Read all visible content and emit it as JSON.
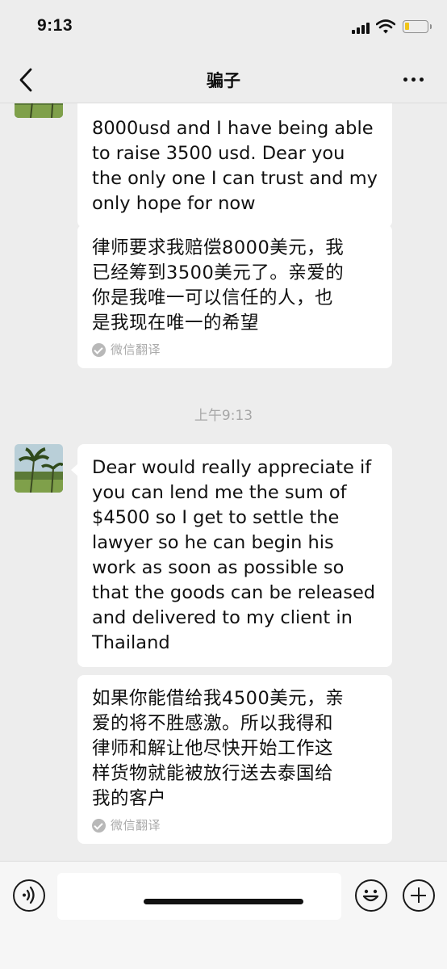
{
  "status_bar": {
    "time": "9:13"
  },
  "nav": {
    "title": "骗子"
  },
  "messages": [
    {
      "text": "8000usd and I have being able\n to raise 3500 usd. Dear you\nthe only one I can trust and my\nonly hope for now"
    },
    {
      "text": "律师要求我赔偿8000美元，我\n已经筹到3500美元了。亲爱的\n你是我唯一可以信任的人，也\n是我现在唯一的希望",
      "translation_label": "微信翻译"
    },
    {
      "text": "Dear would really appreciate if\nyou can lend me the sum of\n$4500 so I get to settle the\nlawyer so he can begin his\nwork as soon as possible so\nthat the goods can be released\n and delivered to my client in\nThailand"
    },
    {
      "text": "如果你能借给我4500美元，亲\n爱的将不胜感激。所以我得和\n律师和解让他尽快开始工作这\n样货物就能被放行送去泰国给\n我的客户",
      "translation_label": "微信翻译"
    }
  ],
  "timestamp": "上午9:13",
  "colors": {
    "background": "#ededed",
    "bubble": "#ffffff",
    "secondary_text": "#a7a7a7"
  },
  "icons": {
    "back": "chevron-left-icon",
    "more": "more-dots-icon",
    "voice": "voice-icon",
    "emoji": "emoji-icon",
    "plus": "plus-icon",
    "translate_check": "check-circle-icon"
  }
}
